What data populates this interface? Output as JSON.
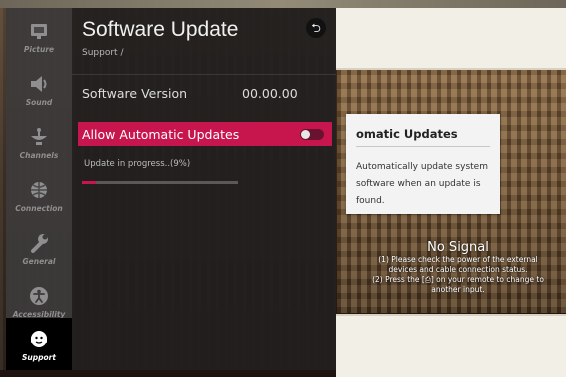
{
  "sidebar": {
    "items": [
      {
        "label": "Picture",
        "icon": "picture-icon"
      },
      {
        "label": "Sound",
        "icon": "speaker-icon"
      },
      {
        "label": "Channels",
        "icon": "satellite-dish-icon"
      },
      {
        "label": "Connection",
        "icon": "globe-icon"
      },
      {
        "label": "General",
        "icon": "wrench-icon"
      },
      {
        "label": "Accessibility",
        "icon": "accessibility-icon"
      }
    ],
    "selected": {
      "label": "Support",
      "icon": "support-icon"
    }
  },
  "panel": {
    "title": "Software Update",
    "breadcrumb": "Support /",
    "back_icon": "back-arrow-icon",
    "software_version": {
      "label": "Software Version",
      "value": "00.00.00"
    },
    "auto_update": {
      "label": "Allow Automatic Updates",
      "enabled": false
    },
    "progress": {
      "text": "Update in progress..(9%)",
      "percent": 9
    }
  },
  "tooltip": {
    "title": "omatic Updates",
    "body": "Automatically update system software when an update is found."
  },
  "no_signal": {
    "title": "No Signal",
    "line1": "(1) Please check the power of the external",
    "line2": "devices and cable connection status.",
    "line3": "(2) Press the [⎙] on your remote to change to",
    "line4": "another input."
  },
  "colors": {
    "accent": "#c7154d",
    "panel": "#201e1e",
    "rail": "#3c3a3a"
  }
}
